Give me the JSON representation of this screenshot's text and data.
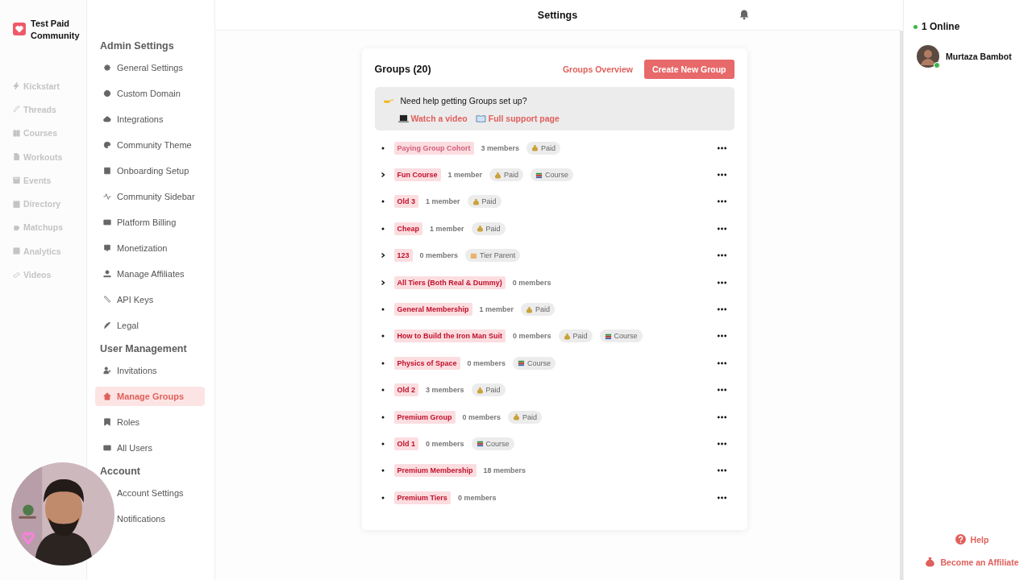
{
  "community": {
    "name": "Test Paid Community"
  },
  "nav": [
    {
      "label": "Kickstart",
      "disabled": true
    },
    {
      "label": "Threads",
      "disabled": true
    },
    {
      "label": "Courses",
      "disabled": true
    },
    {
      "label": "Workouts",
      "disabled": true
    },
    {
      "label": "Events",
      "disabled": true
    },
    {
      "label": "Directory",
      "disabled": true
    },
    {
      "label": "Matchups",
      "disabled": true
    },
    {
      "label": "Analytics",
      "disabled": true
    },
    {
      "label": "Videos",
      "disabled": true
    }
  ],
  "settings_menu": [
    {
      "heading": "Admin Settings",
      "items": [
        {
          "label": "General Settings",
          "selected": false
        },
        {
          "label": "Custom Domain",
          "selected": false
        },
        {
          "label": "Integrations",
          "selected": false
        },
        {
          "label": "Community Theme",
          "selected": false
        },
        {
          "label": "Onboarding Setup",
          "selected": false
        },
        {
          "label": "Community Sidebar",
          "selected": false
        },
        {
          "label": "Platform Billing",
          "selected": false
        },
        {
          "label": "Monetization",
          "selected": false
        },
        {
          "label": "Manage Affiliates",
          "selected": false
        },
        {
          "label": "API Keys",
          "selected": false
        },
        {
          "label": "Legal",
          "selected": false
        }
      ]
    },
    {
      "heading": "User Management",
      "items": [
        {
          "label": "Invitations",
          "selected": false
        },
        {
          "label": "Manage Groups",
          "selected": true
        },
        {
          "label": "Roles",
          "selected": false
        },
        {
          "label": "All Users",
          "selected": false
        }
      ]
    },
    {
      "heading": "Account",
      "items": [
        {
          "label": "Account Settings",
          "selected": false
        },
        {
          "label": "Notifications",
          "selected": false
        }
      ]
    }
  ],
  "header": {
    "title": "Settings"
  },
  "groups_panel": {
    "title": "Groups (20)",
    "overview_link": "Groups Overview",
    "create_button": "Create New Group",
    "help": {
      "question": "Need help getting Groups set up?",
      "links": [
        "Watch a video",
        "Full support page"
      ]
    },
    "groups": [
      {
        "name": "Paying Group Cohort",
        "members": "3 members",
        "expandable": false,
        "highlighted": false,
        "badges": [
          {
            "kind": "paid",
            "label": "Paid"
          }
        ]
      },
      {
        "name": "Fun Course",
        "members": "1 member",
        "expandable": true,
        "highlighted": true,
        "badges": [
          {
            "kind": "paid",
            "label": "Paid"
          },
          {
            "kind": "course",
            "label": "Course"
          }
        ]
      },
      {
        "name": "Old 3",
        "members": "1 member",
        "expandable": false,
        "highlighted": true,
        "badges": [
          {
            "kind": "paid",
            "label": "Paid"
          }
        ]
      },
      {
        "name": "Cheap",
        "members": "1 member",
        "expandable": false,
        "highlighted": true,
        "badges": [
          {
            "kind": "paid",
            "label": "Paid"
          }
        ]
      },
      {
        "name": "123",
        "members": "0 members",
        "expandable": true,
        "highlighted": true,
        "badges": [
          {
            "kind": "tier",
            "label": "Tier Parent"
          }
        ]
      },
      {
        "name": "All Tiers (Both Real & Dummy)",
        "members": "0 members",
        "expandable": true,
        "highlighted": true
      },
      {
        "name": "General Membership",
        "members": "1 member",
        "expandable": false,
        "highlighted": true,
        "badges": [
          {
            "kind": "paid",
            "label": "Paid"
          }
        ]
      },
      {
        "name": "How to Build the Iron Man Suit",
        "members": "0 members",
        "expandable": false,
        "highlighted": true,
        "badges": [
          {
            "kind": "paid",
            "label": "Paid"
          },
          {
            "kind": "course",
            "label": "Course"
          }
        ]
      },
      {
        "name": "Physics of Space",
        "members": "0 members",
        "expandable": false,
        "highlighted": true,
        "badges": [
          {
            "kind": "course",
            "label": "Course"
          }
        ]
      },
      {
        "name": "Old 2",
        "members": "3 members",
        "expandable": false,
        "highlighted": true,
        "badges": [
          {
            "kind": "paid",
            "label": "Paid"
          }
        ]
      },
      {
        "name": "Premium Group",
        "members": "0 members",
        "expandable": false,
        "highlighted": true,
        "badges": [
          {
            "kind": "paid",
            "label": "Paid"
          }
        ]
      },
      {
        "name": "Old 1",
        "members": "0 members",
        "expandable": false,
        "highlighted": true,
        "badges": [
          {
            "kind": "course",
            "label": "Course"
          }
        ]
      },
      {
        "name": "Premium Membership",
        "members": "18 members",
        "expandable": false,
        "highlighted": true
      },
      {
        "name": "Premium Tiers",
        "members": "0 members",
        "expandable": false,
        "highlighted": true
      }
    ]
  },
  "online": {
    "count": "1 Online",
    "users": [
      {
        "name": "Murtaza Bambot",
        "online": true
      }
    ]
  },
  "footer_links": [
    "Help",
    "Become an Affiliate"
  ]
}
